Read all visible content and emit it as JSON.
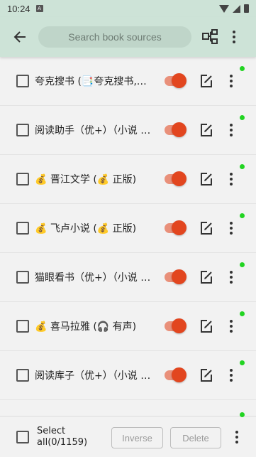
{
  "status_bar": {
    "time": "10:24",
    "badge": "A"
  },
  "toolbar": {
    "search_placeholder": "Search book sources",
    "icons": [
      "back-arrow-icon",
      "group-icon",
      "more-vert-icon"
    ]
  },
  "colors": {
    "accent": "#e2461f",
    "track": "#e9907a",
    "header_bg": "#cde3d7",
    "search_bg": "#bfd5c9",
    "online_dot": "#22d422"
  },
  "sources": [
    {
      "name": "夸克搜书 (📑夸克搜书,通…",
      "enabled": true,
      "online": true
    },
    {
      "name": "阅读助手（优+）（小说 书…",
      "enabled": true,
      "online": true
    },
    {
      "name": "💰 晋江文学 (💰 正版)",
      "enabled": true,
      "online": true
    },
    {
      "name": "💰 飞卢小说 (💰 正版)",
      "enabled": true,
      "online": true
    },
    {
      "name": "猫眼看书（优+）（小说 书…",
      "enabled": true,
      "online": true
    },
    {
      "name": "💰 喜马拉雅 (🎧 有声)",
      "enabled": true,
      "online": true
    },
    {
      "name": "阅读库子（优+）（小说 书…",
      "enabled": true,
      "online": true
    }
  ],
  "bottom_bar": {
    "select_all_label": "Select all(0/1159)",
    "inverse_label": "Inverse",
    "delete_label": "Delete"
  }
}
